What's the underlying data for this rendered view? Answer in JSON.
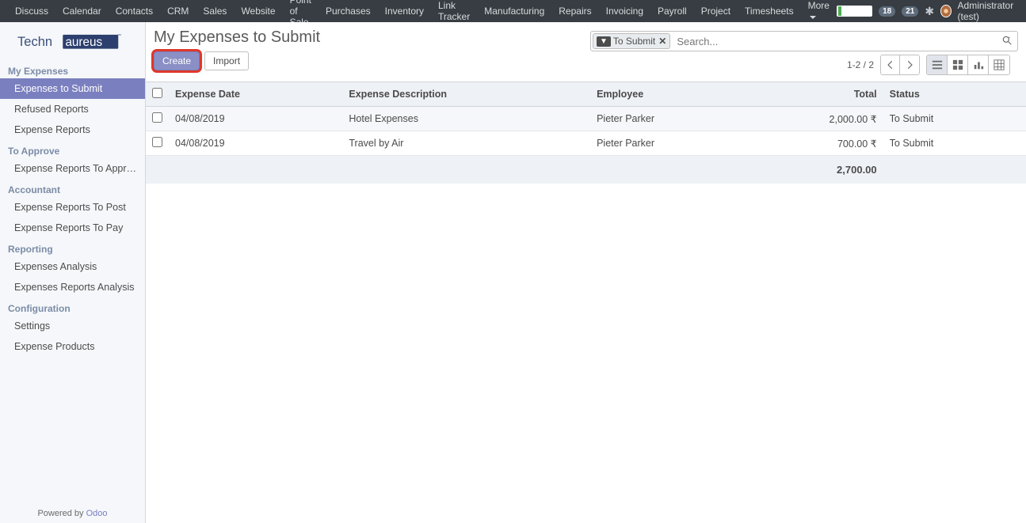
{
  "navbar": {
    "items": [
      "Discuss",
      "Calendar",
      "Contacts",
      "CRM",
      "Sales",
      "Website",
      "Point of Sale",
      "Purchases",
      "Inventory",
      "Link Tracker",
      "Manufacturing",
      "Repairs",
      "Invoicing",
      "Payroll",
      "Project",
      "Timesheets"
    ],
    "more_label": "More",
    "badge1": "18",
    "badge2": "21",
    "user": "Administrator (test)"
  },
  "sidebar": {
    "logo_text1": "Techn",
    "logo_text2": "aureus",
    "sections": [
      {
        "title": "My Expenses",
        "items": [
          {
            "label": "Expenses to Submit",
            "active": true
          },
          {
            "label": "Refused Reports",
            "active": false
          },
          {
            "label": "Expense Reports",
            "active": false
          }
        ]
      },
      {
        "title": "To Approve",
        "items": [
          {
            "label": "Expense Reports To Appr…",
            "active": false
          }
        ]
      },
      {
        "title": "Accountant",
        "items": [
          {
            "label": "Expense Reports To Post",
            "active": false
          },
          {
            "label": "Expense Reports To Pay",
            "active": false
          }
        ]
      },
      {
        "title": "Reporting",
        "items": [
          {
            "label": "Expenses Analysis",
            "active": false
          },
          {
            "label": "Expenses Reports Analysis",
            "active": false
          }
        ]
      },
      {
        "title": "Configuration",
        "items": [
          {
            "label": "Settings",
            "active": false
          },
          {
            "label": "Expense Products",
            "active": false
          }
        ]
      }
    ],
    "powered": "Powered by ",
    "powered_link": "Odoo"
  },
  "header": {
    "title": "My Expenses to Submit",
    "create": "Create",
    "import": "Import",
    "filter_label": "To Submit",
    "search_placeholder": "Search..."
  },
  "pager": "1-2 / 2",
  "columns": {
    "date": "Expense Date",
    "desc": "Expense Description",
    "emp": "Employee",
    "total": "Total",
    "status": "Status"
  },
  "rows": [
    {
      "date": "04/08/2019",
      "desc": "Hotel Expenses",
      "emp": "Pieter Parker",
      "total": "2,000.00 ₹",
      "status": "To Submit"
    },
    {
      "date": "04/08/2019",
      "desc": "Travel by Air",
      "emp": "Pieter Parker",
      "total": "700.00 ₹",
      "status": "To Submit"
    }
  ],
  "footer_total": "2,700.00"
}
